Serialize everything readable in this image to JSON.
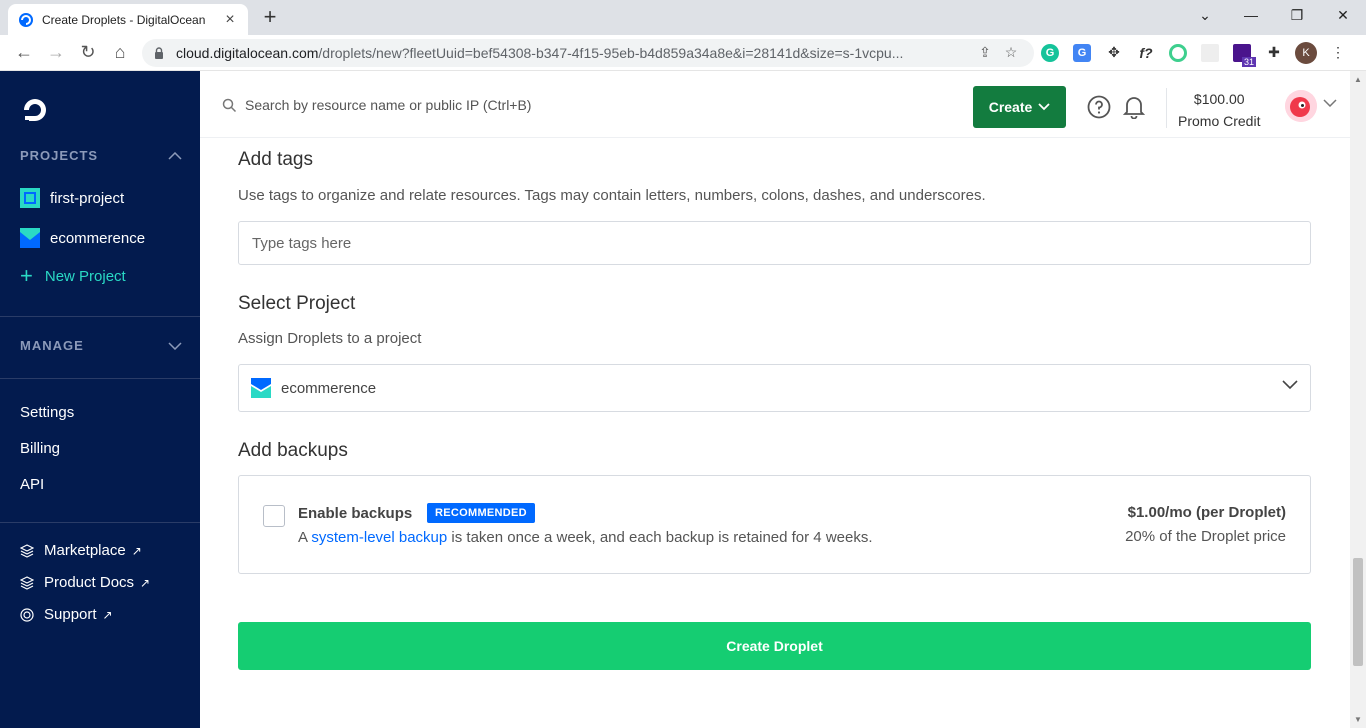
{
  "browser": {
    "tab_title": "Create Droplets - DigitalOcean",
    "new_tab": "+",
    "url_host": "cloud.digitalocean.com",
    "url_path": "/droplets/new?fleetUuid=bef54308-b347-4f15-95eb-b4d859a34a8e&i=28141d&size=s-1vcpu...",
    "profile_initial": "K",
    "ext_badge": "31"
  },
  "sidebar": {
    "projects_heading": "PROJECTS",
    "projects": [
      {
        "label": "first-project"
      },
      {
        "label": "ecommerence"
      }
    ],
    "new_project": "New Project",
    "manage_heading": "MANAGE",
    "links": [
      "Settings",
      "Billing",
      "API"
    ],
    "external": [
      "Marketplace",
      "Product Docs",
      "Support"
    ]
  },
  "topbar": {
    "search_placeholder": "Search by resource name or public IP (Ctrl+B)",
    "create_label": "Create",
    "credit_amount": "$100.00",
    "credit_label": "Promo Credit"
  },
  "tags": {
    "title": "Add tags",
    "description": "Use tags to organize and relate resources. Tags may contain letters, numbers, colons, dashes, and underscores.",
    "placeholder": "Type tags here"
  },
  "project": {
    "title": "Select Project",
    "description": "Assign Droplets to a project",
    "selected": "ecommerence"
  },
  "backups": {
    "title": "Add backups",
    "label": "Enable backups",
    "badge": "RECOMMENDED",
    "desc_prefix": "A ",
    "desc_link": "system-level backup",
    "desc_suffix": " is taken once a week, and each backup is retained for 4 weeks.",
    "price": "$1.00/mo (per Droplet)",
    "percent": "20% of the Droplet price"
  },
  "submit": {
    "label": "Create Droplet"
  },
  "colors": {
    "sidebar_bg": "#031b4e",
    "create_green": "#137c3f",
    "submit_green": "#15cd72",
    "accent_blue": "#0069ff",
    "new_project_teal": "#2ad9c5"
  }
}
